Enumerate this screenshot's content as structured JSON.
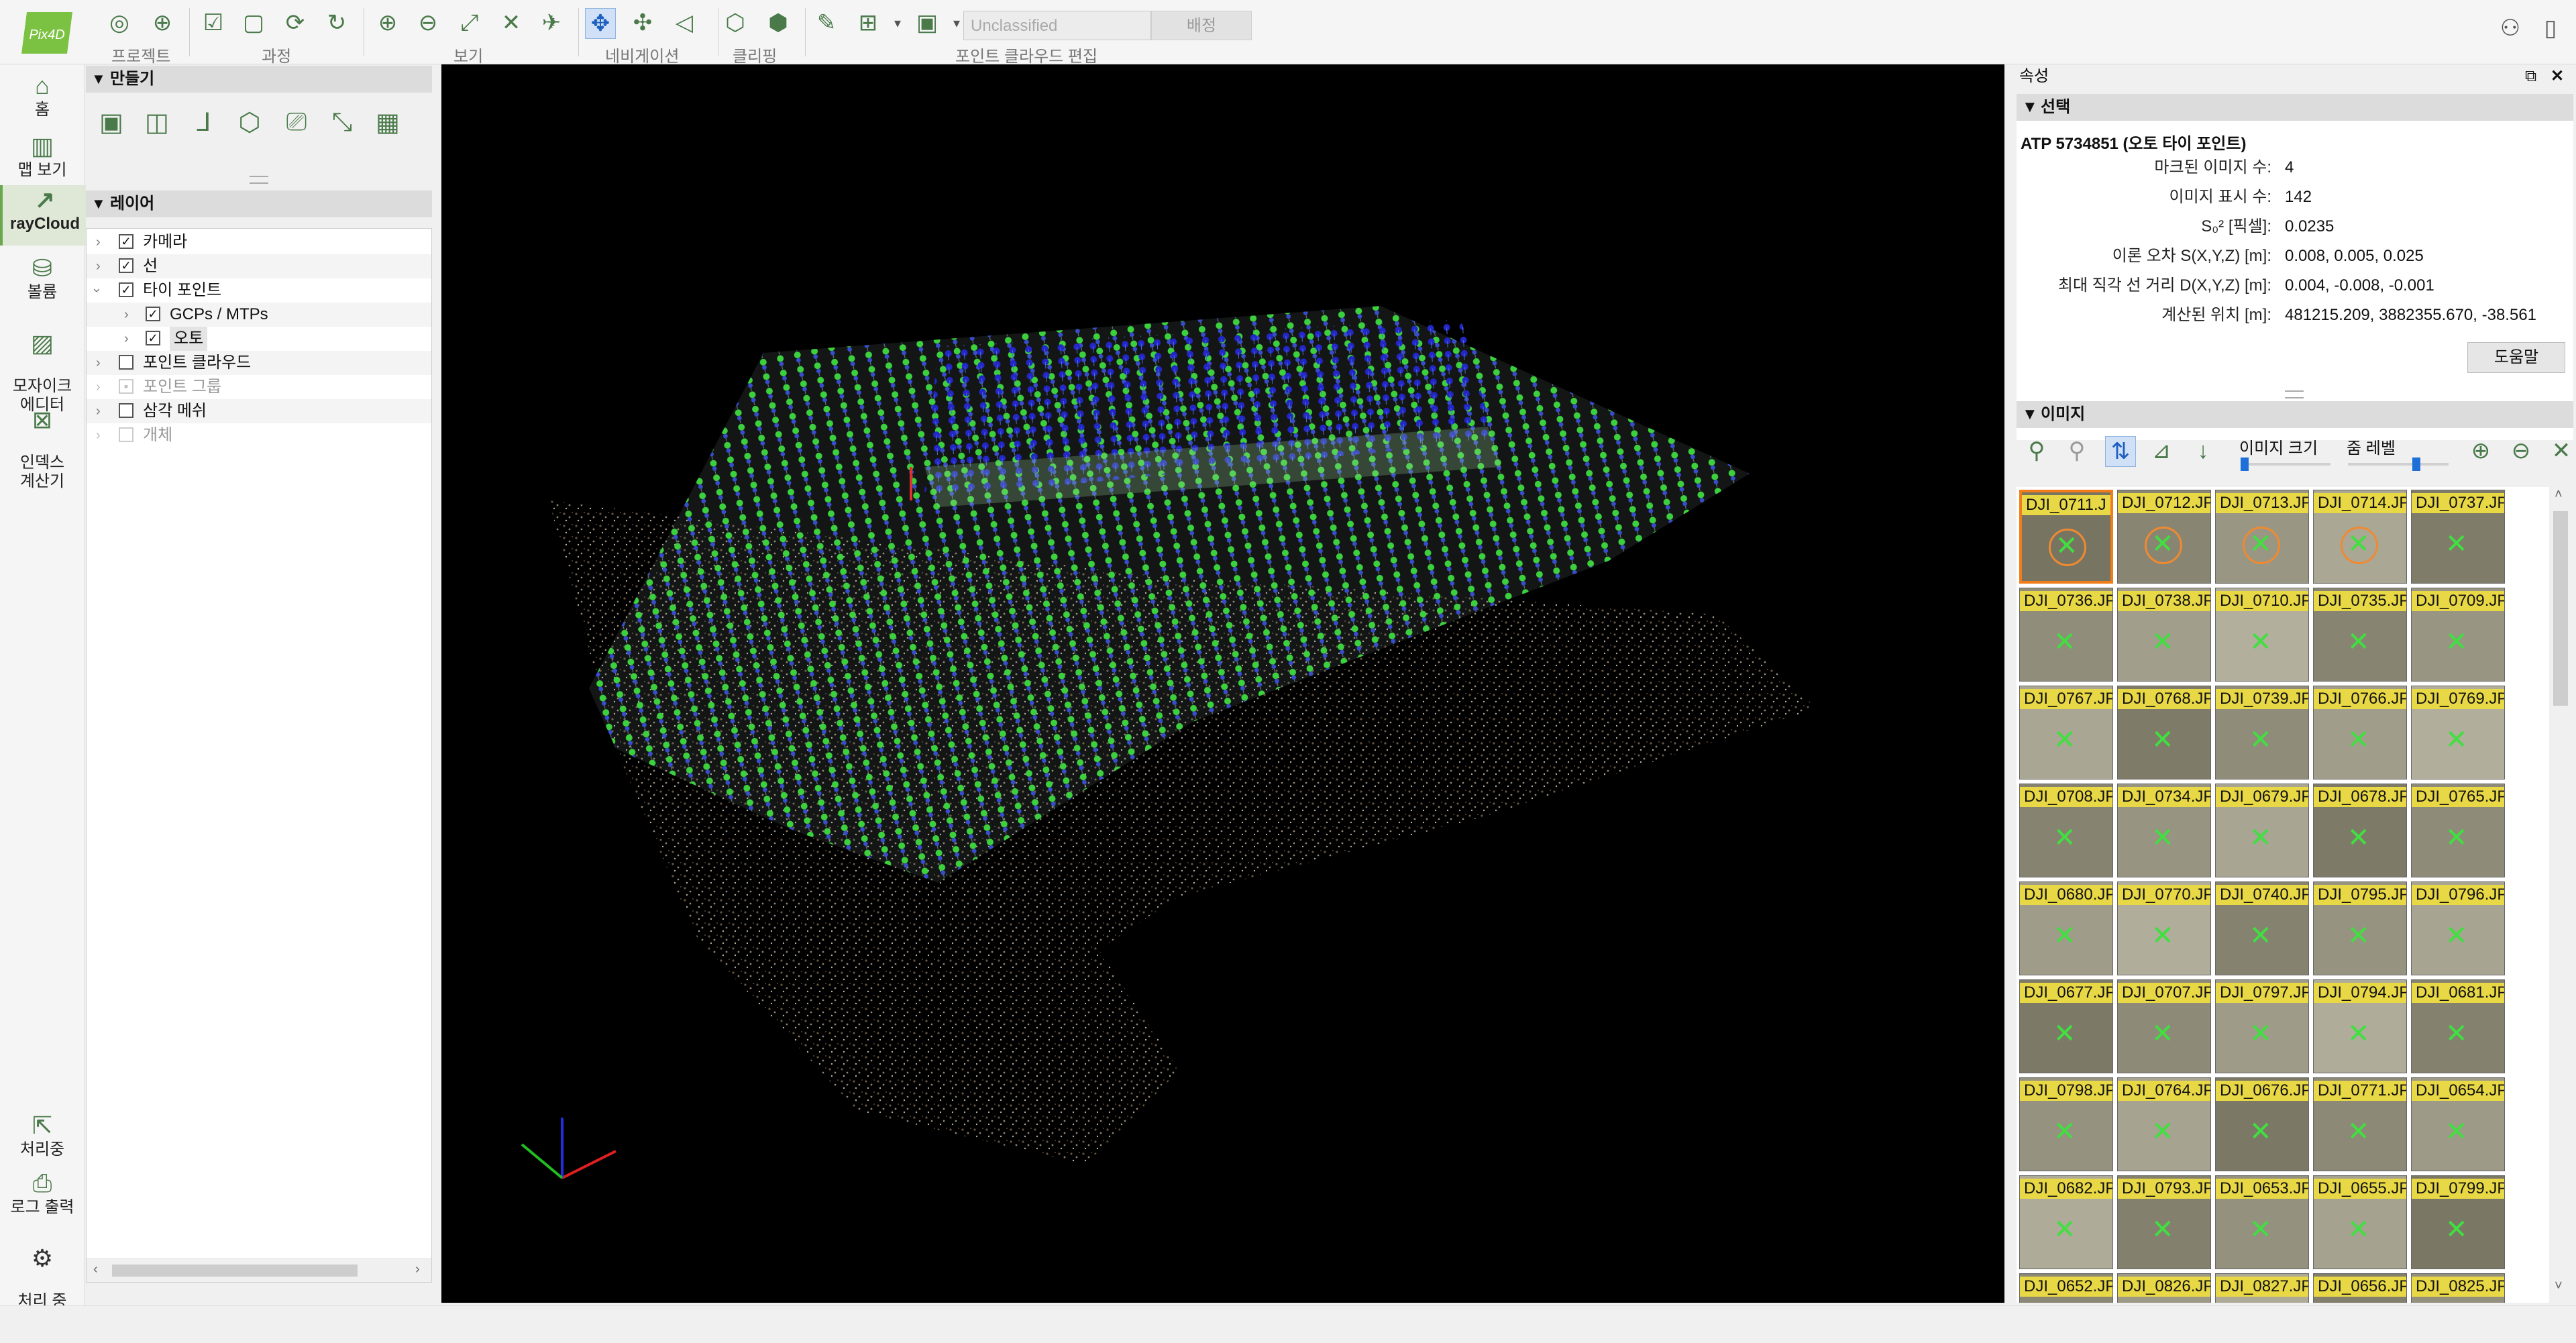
{
  "app": {
    "logo_text": "Pix4D"
  },
  "toolbar": {
    "groups": [
      "프로젝트",
      "과정",
      "보기",
      "네비게이션",
      "클리핑",
      "포인트 클라우드 편집"
    ],
    "class_combo": "Unclassified",
    "assign_button": "배정"
  },
  "leftnav": {
    "home": "홈",
    "map": "맵 보기",
    "raycloud": "rayCloud",
    "volume": "볼륨",
    "mosaic": "모자이크\n에디터",
    "index": "인덱스\n계산기",
    "processing": "처리중",
    "log": "로그 출력",
    "options": "처리 중\n옵션"
  },
  "create_section": {
    "title": "만들기"
  },
  "layers_section": {
    "title": "레이어",
    "items": [
      {
        "label": "카메라",
        "checked": true
      },
      {
        "label": "선",
        "checked": true
      },
      {
        "label": "타이 포인트",
        "checked": true
      },
      {
        "label": "GCPs / MTPs",
        "checked": true
      },
      {
        "label": "오토",
        "checked": true
      },
      {
        "label": "포인트 클라우드",
        "checked": false
      },
      {
        "label": "포인트 그룹",
        "checked": false
      },
      {
        "label": "삼각 메쉬",
        "checked": false
      },
      {
        "label": "개체",
        "checked": false
      }
    ]
  },
  "properties": {
    "title": "속성",
    "selection_title": "선택",
    "selected_name": "ATP 5734851 (오토 타이 포인트)",
    "rows": [
      {
        "key": "마크된 이미지 수:",
        "value": "4"
      },
      {
        "key": "이미지 표시 수:",
        "value": "142"
      },
      {
        "key": "S₀² [픽셀]:",
        "value": "0.0235"
      },
      {
        "key": "이론 오차 S(X,Y,Z) [m]:",
        "value": "0.008, 0.005, 0.025"
      },
      {
        "key": "최대 직각 선 거리 D(X,Y,Z) [m]:",
        "value": "0.004, -0.008, -0.001"
      },
      {
        "key": "계산된 위치 [m]:",
        "value": "481215.209, 3882355.670, -38.561"
      }
    ],
    "help_button": "도움말"
  },
  "images": {
    "title": "이미지",
    "image_size_label": "이미지 크기",
    "zoom_label": "줌 레벨",
    "thumbs": [
      [
        "DJI_0711.J",
        "DJI_0712.JP",
        "DJI_0713.JP",
        "DJI_0714.JP",
        "DJI_0737.JP"
      ],
      [
        "DJI_0736.JP",
        "DJI_0738.JP",
        "DJI_0710.JP",
        "DJI_0735.JP",
        "DJI_0709.JP"
      ],
      [
        "DJI_0767.JP",
        "DJI_0768.JP",
        "DJI_0739.JP",
        "DJI_0766.JP",
        "DJI_0769.JP"
      ],
      [
        "DJI_0708.JP",
        "DJI_0734.JP",
        "DJI_0679.JP",
        "DJI_0678.JP",
        "DJI_0765.JP"
      ],
      [
        "DJI_0680.JP",
        "DJI_0770.JP",
        "DJI_0740.JP",
        "DJI_0795.JP",
        "DJI_0796.JP"
      ],
      [
        "DJI_0677.JP",
        "DJI_0707.JP",
        "DJI_0797.JP",
        "DJI_0794.JP",
        "DJI_0681.JP"
      ],
      [
        "DJI_0798.JP",
        "DJI_0764.JP",
        "DJI_0676.JP",
        "DJI_0771.JP",
        "DJI_0654.JP"
      ],
      [
        "DJI_0682.JP",
        "DJI_0793.JP",
        "DJI_0653.JP",
        "DJI_0655.JP",
        "DJI_0799.JP"
      ],
      [
        "DJI_0652.JP",
        "DJI_0826.JP",
        "DJI_0827.JP",
        "DJI_0656.JP",
        "DJI_0825.JP"
      ]
    ]
  }
}
